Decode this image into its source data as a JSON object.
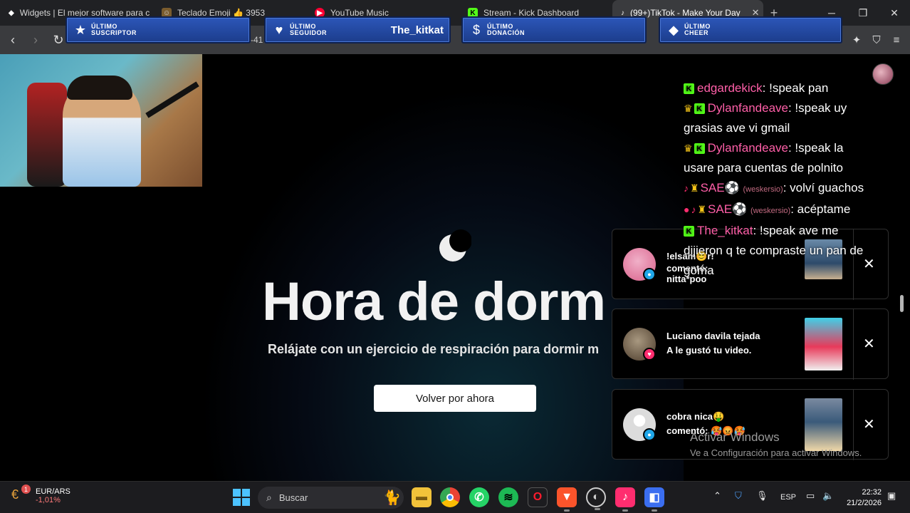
{
  "browser": {
    "tabs": [
      {
        "label": "Widgets | El mejor software para c",
        "icon": "widget-icon"
      },
      {
        "label": "Teclado Emoji 👍 3953",
        "icon": "emoji-icon"
      },
      {
        "label": "YouTube Music",
        "icon": "youtube-music-icon"
      },
      {
        "label": "Stream - Kick Dashboard",
        "icon": "kick-icon"
      },
      {
        "label": "(99+)TikTok - Make Your Day",
        "icon": "tiktok-icon"
      }
    ],
    "tab_close": "✕",
    "new_tab": "+",
    "address_fragment": "-41"
  },
  "overlay": {
    "banners": [
      {
        "title_line1": "ÚLTIMO",
        "title_line2": "SUSCRIPTOR",
        "value": "",
        "icon": "star-icon"
      },
      {
        "title_line1": "ÚLTIMO",
        "title_line2": "SEGUIDOR",
        "value": "The_kitkat",
        "icon": "heart-icon"
      },
      {
        "title_line1": "ÚLTIMO",
        "title_line2": "DONACIÓN",
        "value": "",
        "icon": "dollar-icon"
      },
      {
        "title_line1": "ÚLTIMO",
        "title_line2": "CHEER",
        "value": "",
        "icon": "diamond-icon"
      }
    ]
  },
  "page": {
    "title": "Hora de dorm",
    "subtitle": "Relájate con un ejercicio de respiración para dormir m",
    "button_label": "Volver por ahora"
  },
  "chat": [
    {
      "user": "edgardekick",
      "user_color": "#ff5fa8",
      "text": ": !speak pan",
      "badges": [
        "kick"
      ]
    },
    {
      "user": "Dylanfandeave",
      "user_color": "#ff5fa8",
      "text": ": !speak uy grasias ave vi gmail",
      "badges": [
        "crown",
        "kick"
      ]
    },
    {
      "user": "Dylanfandeave",
      "user_color": "#ff5fa8",
      "text": ": !speak la usare para cuentas de polnito",
      "badges": [
        "crown",
        "kick"
      ]
    },
    {
      "user": "SAE⚽",
      "user_color": "#ff5fa8",
      "handle": "(weskersio)",
      "text": ": volví guachos",
      "badges": [
        "tiktok",
        "trophy"
      ]
    },
    {
      "user": "SAE⚽",
      "user_color": "#ff5fa8",
      "handle": "(weskersio)",
      "text": ": acéptame",
      "badges": [
        "pig",
        "tiktok",
        "trophy"
      ]
    },
    {
      "user": "The_kitkat",
      "user_color": "#ff5fa8",
      "text": ": !speak ave me dijieron q te compraste un pan de goma",
      "badges": [
        "kick"
      ]
    }
  ],
  "notifications": [
    {
      "name": "!elsam😊r!",
      "action": "comentó: nitta*poo",
      "badge_color": "#1fa6e8",
      "badge_icon": "comment-icon",
      "avatar_color": "#d9608a"
    },
    {
      "name": "Luciano davila tejada",
      "action": "A le gustó tu video.",
      "badge_color": "#ff2d6f",
      "badge_icon": "heart-icon",
      "avatar_color": "#6a5a4a"
    },
    {
      "name": "cobra nica🤑",
      "action": "comentó: 🥵😡🥵",
      "badge_color": "#1fa6e8",
      "badge_icon": "comment-icon",
      "avatar_color": "#dcdcdc"
    }
  ],
  "windows_activation": {
    "line1": "Activar Windows",
    "line2": "Ve a Configuración para activar Windows."
  },
  "taskbar": {
    "ticker_name": "EUR/ARS",
    "ticker_change": "-1,01%",
    "ticker_badge": "1",
    "search_placeholder": "Buscar",
    "language": "ESP",
    "time": "22:32",
    "date": "21/2/2026"
  }
}
